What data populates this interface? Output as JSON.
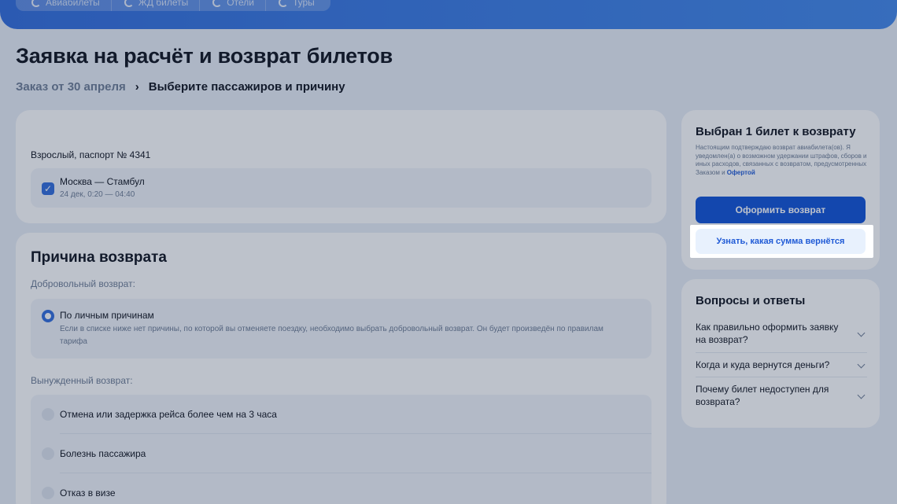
{
  "nav": {
    "tabs": [
      {
        "label": "Авиабилеты",
        "icon": "brand-logo-icon"
      },
      {
        "label": "ЖД билеты",
        "icon": "brand-logo-icon"
      },
      {
        "label": "Отели",
        "icon": "brand-logo-icon"
      },
      {
        "label": "Туры",
        "icon": "brand-logo-icon"
      }
    ]
  },
  "page": {
    "title": "Заявка на расчёт и возврат билетов"
  },
  "breadcrumb": {
    "link": "Заказ от 30 апреля",
    "separator": "›",
    "current": "Выберите пассажиров и причину"
  },
  "passenger": {
    "title": "Взрослый, паспорт № 4341",
    "route": {
      "checked": true,
      "name": "Москва — Стамбул",
      "time": "24 дек, 0:20 — 04:40"
    }
  },
  "reason": {
    "title": "Причина возврата",
    "voluntary_label": "Добровольный возврат:",
    "voluntary_option": {
      "label": "По личным причинам",
      "description": "Если в списке ниже нет причины, по которой вы отменяете поездку, необходимо выбрать добровольный возврат. Он будет произведён по правилам тарифа",
      "selected": true
    },
    "forced_label": "Вынужденный возврат:",
    "forced_options": [
      {
        "label": "Отмена или задержка рейса более чем на 3 часа"
      },
      {
        "label": "Болезнь пассажира"
      },
      {
        "label": "Отказ в визе"
      }
    ]
  },
  "refund": {
    "title": "Выбран 1 билет к возврату",
    "notice": "Настоящим подтверждаю возврат авиабилета(ов). Я уведомлен(а) о возможном удержании штрафов, сборов и иных расходов, связанных с возвратом, предусмотренных Заказом и",
    "notice_link": "Офертой",
    "primary_button": "Оформить возврат",
    "secondary_button": "Узнать, какая сумма вернётся"
  },
  "faq": {
    "title": "Вопросы и ответы",
    "items": [
      {
        "question": "Как правильно оформить заявку на возврат?"
      },
      {
        "question": "Когда и куда вернутся деньги?"
      },
      {
        "question": "Почему билет недоступен для возврата?"
      }
    ]
  },
  "colors": {
    "accent": "#0c4fd6",
    "header": "#2f6bdc",
    "muted": "#6b7a93",
    "background": "#e9eef6"
  }
}
